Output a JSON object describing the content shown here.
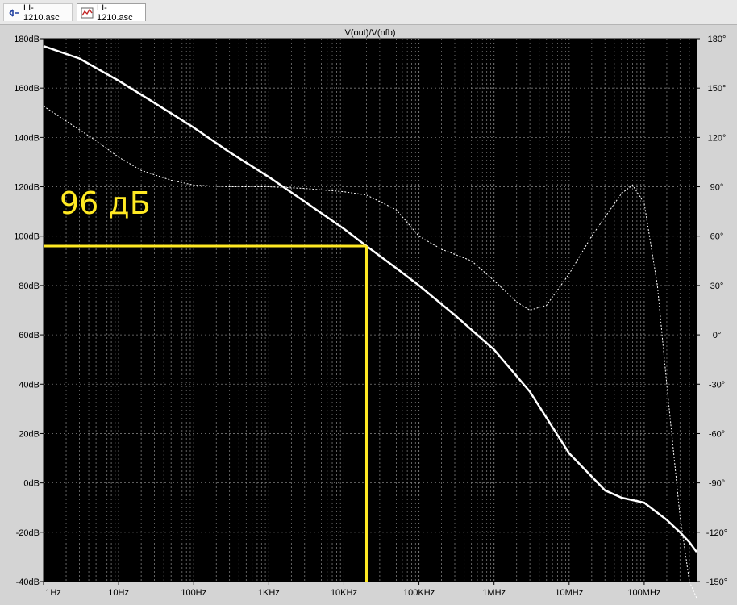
{
  "tabs": [
    {
      "label": "LI-1210.asc",
      "icon": "schematic-icon"
    },
    {
      "label": "LI-1210.asc",
      "icon": "waveform-icon"
    }
  ],
  "colors": {
    "plot_bg": "#000000",
    "grid": "#7a7a7a",
    "trace": "#ffffff",
    "annotation": "#ffe923",
    "frame_bg": "#d4d4d4"
  },
  "chart_data": {
    "type": "line",
    "title": "V(out)/V(nfb)",
    "x_scale": "log",
    "xlim": [
      1,
      500000000
    ],
    "x_ticks": [
      {
        "value": 1,
        "label": "1Hz"
      },
      {
        "value": 10,
        "label": "10Hz"
      },
      {
        "value": 100,
        "label": "100Hz"
      },
      {
        "value": 1000,
        "label": "1KHz"
      },
      {
        "value": 10000,
        "label": "10KHz"
      },
      {
        "value": 100000,
        "label": "100KHz"
      },
      {
        "value": 1000000,
        "label": "1MHz"
      },
      {
        "value": 10000000,
        "label": "10MHz"
      },
      {
        "value": 100000000,
        "label": "100MHz"
      }
    ],
    "ylim_left": [
      -40,
      180
    ],
    "y_ticks_left": [
      {
        "value": 180,
        "label": "180dB"
      },
      {
        "value": 160,
        "label": "160dB"
      },
      {
        "value": 140,
        "label": "140dB"
      },
      {
        "value": 120,
        "label": "120dB"
      },
      {
        "value": 100,
        "label": "100dB"
      },
      {
        "value": 80,
        "label": "80dB"
      },
      {
        "value": 60,
        "label": "60dB"
      },
      {
        "value": 40,
        "label": "40dB"
      },
      {
        "value": 20,
        "label": "20dB"
      },
      {
        "value": 0,
        "label": "0dB"
      },
      {
        "value": -20,
        "label": "-20dB"
      },
      {
        "value": -40,
        "label": "-40dB"
      }
    ],
    "ylim_right": [
      -150,
      180
    ],
    "y_ticks_right": [
      {
        "value": 180,
        "label": "180°"
      },
      {
        "value": 150,
        "label": "150°"
      },
      {
        "value": 120,
        "label": "120°"
      },
      {
        "value": 90,
        "label": "90°"
      },
      {
        "value": 60,
        "label": "60°"
      },
      {
        "value": 30,
        "label": "30°"
      },
      {
        "value": 0,
        "label": "0°"
      },
      {
        "value": -30,
        "label": "-30°"
      },
      {
        "value": -60,
        "label": "-60°"
      },
      {
        "value": -90,
        "label": "-90°"
      },
      {
        "value": -120,
        "label": "-120°"
      },
      {
        "value": -150,
        "label": "-150°"
      }
    ],
    "grid": true,
    "series": [
      {
        "axis": "left",
        "style": "solid",
        "x": [
          1,
          3,
          10,
          30,
          100,
          300,
          1000,
          3000,
          10000,
          20000,
          50000,
          100000,
          300000,
          1000000,
          3000000,
          10000000,
          30000000,
          50000000,
          100000000,
          200000000,
          300000000,
          400000000,
          500000000
        ],
        "values": [
          177,
          172,
          163,
          154,
          144,
          134,
          124,
          114,
          103,
          96,
          87,
          80,
          68,
          54,
          37,
          12,
          -3,
          -6,
          -8,
          -15,
          -20,
          -24,
          -28
        ]
      },
      {
        "axis": "right",
        "style": "dashed",
        "x": [
          1,
          2,
          5,
          10,
          20,
          50,
          100,
          300,
          1000,
          3000,
          10000,
          20000,
          50000,
          100000,
          200000,
          500000,
          1000000,
          2000000,
          3000000,
          5000000,
          10000000,
          20000000,
          50000000,
          70000000,
          100000000,
          150000000,
          200000000,
          300000000,
          400000000,
          500000000
        ],
        "values": [
          139,
          130,
          118,
          108,
          100,
          94,
          91,
          90,
          90,
          89,
          87,
          85,
          76,
          60,
          52,
          45,
          33,
          20,
          15,
          18,
          37,
          60,
          86,
          91,
          80,
          30,
          -30,
          -110,
          -150,
          -160
        ]
      }
    ],
    "annotations": [
      {
        "text": "96 дБ",
        "x": 20000,
        "y": 96
      }
    ]
  }
}
